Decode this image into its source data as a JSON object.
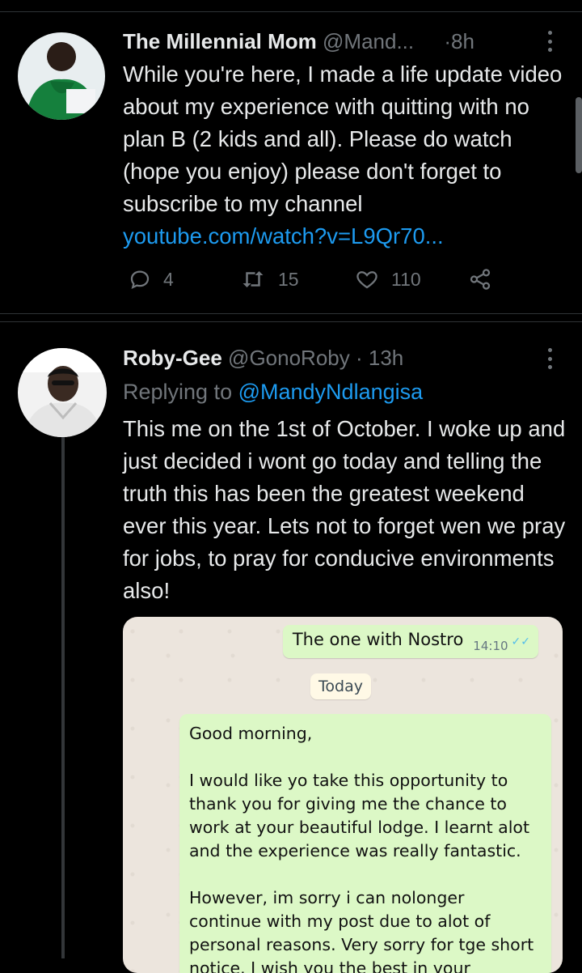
{
  "tweet1": {
    "name": "The Millennial Mom",
    "handle": "@Mand...",
    "dot": "·",
    "time": "8h",
    "text": "While you're here, I made a life update video about my experience with quitting with no plan B (2 kids and all). Please do watch (hope you enjoy) please don't forget to subscribe to my channel",
    "link": "youtube.com/watch?v=L9Qr70...",
    "replies": "4",
    "retweets": "15",
    "likes": "110"
  },
  "tweet2": {
    "name": "Roby-Gee",
    "handle": "@GonoRoby",
    "dot": "·",
    "time": "13h",
    "replying_prefix": "Replying to",
    "replying_handle": "@MandyNdlangisa",
    "text": "This me on the 1st of October. I woke up and just decided i wont go today and telling the truth this has been the greatest weekend ever this year. Lets not to forget wen we pray for jobs, to pray for conducive environments also!"
  },
  "chat": {
    "out_message": "The one with Nostro",
    "out_time": "14:10",
    "date_chip": "Today",
    "msg_greeting": "Good morning,",
    "msg_p1": "I would like yo take this opportunity to thank you for giving me the chance to work at your beautiful lodge. I learnt alot and the experience was really fantastic.",
    "msg_p2": "However, im sorry i can nolonger continue with my post due to alot of personal reasons. Very sorry for tge short notice. I wish you the best in your"
  },
  "colors": {
    "background": "#000000",
    "text": "#e7e9ea",
    "muted": "#71767b",
    "link": "#1d9bf0",
    "chat_bubble": "#dcf8c6"
  }
}
